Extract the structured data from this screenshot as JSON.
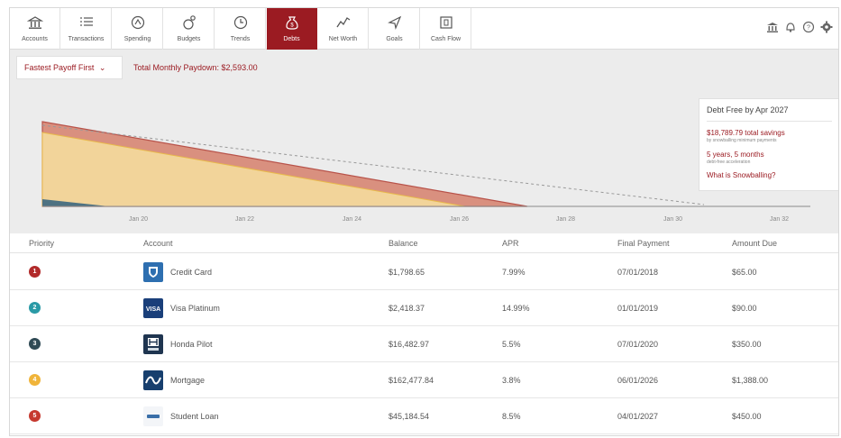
{
  "nav": {
    "items": [
      {
        "label": "Accounts",
        "icon": "bank-icon"
      },
      {
        "label": "Transactions",
        "icon": "list-icon"
      },
      {
        "label": "Spending",
        "icon": "spending-icon"
      },
      {
        "label": "Budgets",
        "icon": "budgets-icon"
      },
      {
        "label": "Trends",
        "icon": "clock-icon"
      },
      {
        "label": "Debts",
        "icon": "money-bag-icon"
      },
      {
        "label": "Net Worth",
        "icon": "line-chart-icon"
      },
      {
        "label": "Goals",
        "icon": "goal-arrow-icon"
      },
      {
        "label": "Cash Flow",
        "icon": "calendar-icon"
      }
    ],
    "active": "Debts",
    "tools": [
      "bank-icon",
      "bell-icon",
      "help-icon",
      "gear-icon"
    ]
  },
  "filter": {
    "strategy": "Fastest Payoff First",
    "total_label": "Total Monthly Paydown: $2,593.00"
  },
  "callout": {
    "title": "Debt Free by Apr 2027",
    "savings": "$18,789.79 total savings",
    "savings_note": "by snowballing minimum payments",
    "time": "5 years, 5 months",
    "time_note": "debt-free acceleration",
    "link": "What is Snowballing?"
  },
  "chart_data": {
    "type": "area",
    "x_ticks": [
      "Jan 20",
      "Jan 22",
      "Jan 24",
      "Jan 26",
      "Jan 28",
      "Jan 30",
      "Jan 32"
    ],
    "colors": {
      "student_loan": "#d9907f",
      "mortgage": "#f2d49a",
      "honda": "#4e7282",
      "baseline": "#999999"
    }
  },
  "table": {
    "headers": {
      "priority": "Priority",
      "account": "Account",
      "balance": "Balance",
      "apr": "APR",
      "final": "Final Payment",
      "amount": "Amount Due"
    },
    "rows": [
      {
        "priority": "1",
        "color": "#b12a2a",
        "logo": "shield-logo-icon",
        "logo_text": "",
        "account": "Credit Card",
        "balance": "$1,798.65",
        "apr": "7.99%",
        "final": "07/01/2018",
        "amount": "$65.00"
      },
      {
        "priority": "2",
        "color": "#2a9aa6",
        "logo": "visa-logo-icon",
        "logo_text": "VISA",
        "account": "Visa Platinum",
        "balance": "$2,418.37",
        "apr": "14.99%",
        "final": "01/01/2019",
        "amount": "$90.00"
      },
      {
        "priority": "3",
        "color": "#2f4a55",
        "logo": "honda-logo-icon",
        "logo_text": "",
        "account": "Honda Pilot",
        "balance": "$16,482.97",
        "apr": "5.5%",
        "final": "07/01/2020",
        "amount": "$350.00"
      },
      {
        "priority": "4",
        "color": "#f0b43a",
        "logo": "mortgage-logo-icon",
        "logo_text": "",
        "account": "Mortgage",
        "balance": "$162,477.84",
        "apr": "3.8%",
        "final": "06/01/2026",
        "amount": "$1,388.00"
      },
      {
        "priority": "5",
        "color": "#c6392f",
        "logo": "student-loan-logo-icon",
        "logo_text": "",
        "account": "Student Loan",
        "balance": "$45,184.54",
        "apr": "8.5%",
        "final": "04/01/2027",
        "amount": "$450.00"
      }
    ]
  }
}
